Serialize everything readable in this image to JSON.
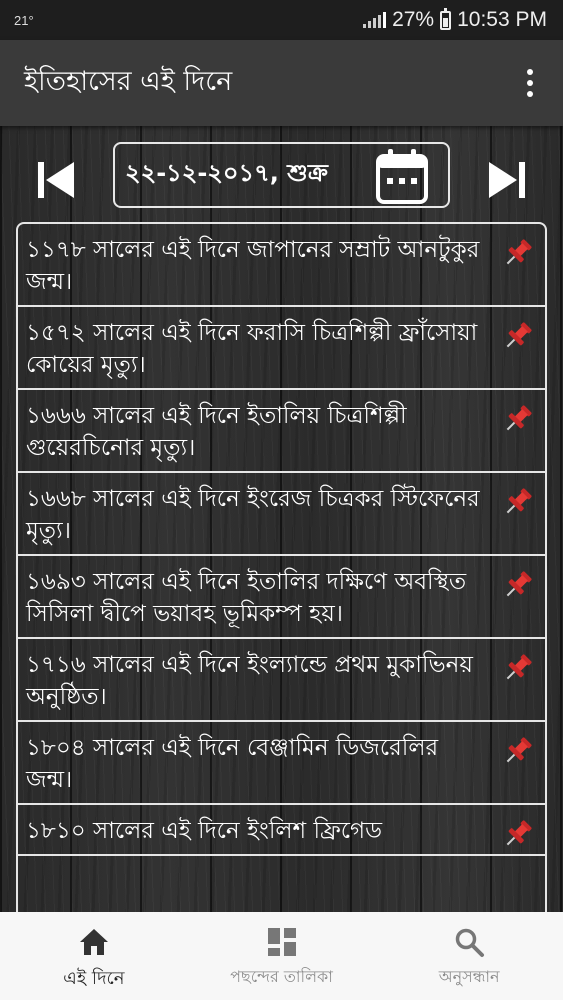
{
  "status_bar": {
    "temperature": "21°",
    "battery": "27%",
    "time": "10:53 PM"
  },
  "app_bar": {
    "title": "ইতিহাসের এই দিনে",
    "menu_icon": "more-vert-icon"
  },
  "date_nav": {
    "date_label": "২২-১২-২০১৭, শুক্র",
    "prev_icon": "skip-previous-icon",
    "next_icon": "skip-next-icon",
    "calendar_icon": "calendar-icon"
  },
  "events": [
    {
      "text": "১১৭৮ সালের এই দিনে জাপানের সম্রাট আনটুকুর জন্ম।"
    },
    {
      "text": "১৫৭২ সালের এই দিনে ফরাসি চিত্রশিল্পী ফ্রাঁসোয়া কোয়ের মৃত্যু।"
    },
    {
      "text": "১৬৬৬ সালের এই দিনে ইতালিয় চিত্রশিল্পী গুয়েরচিনোর মৃত্যু।"
    },
    {
      "text": "১৬৬৮ সালের এই দিনে ইংরেজ চিত্রকর স্টিফেনের মৃত্যু।"
    },
    {
      "text": "১৬৯৩ সালের এই দিনে ইতালির দক্ষিণে অবস্থিত সিসিলা দ্বীপে ভয়াবহ ভূমিকম্প হয়।"
    },
    {
      "text": "১৭১৬ সালের এই দিনে ইংল্যান্ডে প্রথম মুকাভিনয় অনুষ্ঠিত।"
    },
    {
      "text": "১৮০৪ সালের এই দিনে বেঞ্জামিন ডিজরেলির জন্ম।"
    },
    {
      "text": "১৮১০ সালের এই দিনে ইংলিশ ফ্রিগেড"
    }
  ],
  "bottom_nav": {
    "tabs": [
      {
        "label": "এই দিনে",
        "icon": "home-icon"
      },
      {
        "label": "পছন্দের তালিকা",
        "icon": "dashboard-icon"
      },
      {
        "label": "অনুসন্ধান",
        "icon": "search-icon"
      }
    ]
  },
  "colors": {
    "app_bar": "#3a3a3a",
    "status_bar": "#1e1e1e",
    "pin": "#e53935",
    "bottom_nav": "#f7f7f7"
  }
}
